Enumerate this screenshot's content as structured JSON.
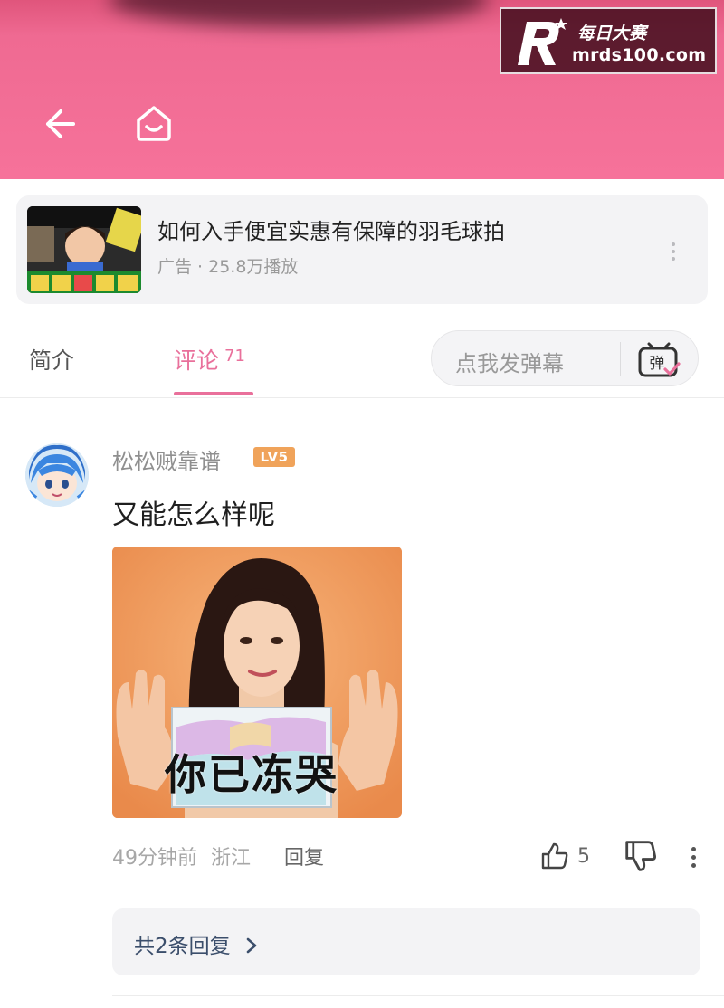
{
  "watermark": {
    "brand_cn": "每日大赛",
    "domain": "mrds100.com"
  },
  "nav": {
    "back_icon": "back-arrow-icon",
    "home_icon": "home-icon"
  },
  "ad": {
    "title": "如何入手便宜实惠有保障的羽毛球拍",
    "meta": "广告 · 25.8万播放"
  },
  "tabs": {
    "intro": "简介",
    "comments": "评论",
    "comments_count": "71",
    "danmaku_placeholder": "点我发弹幕",
    "danmaku_icon_label": "弹"
  },
  "comment": {
    "username": "松松贼靠谱",
    "level": "LV5",
    "text": "又能怎么样呢",
    "image_caption": "你已冻哭",
    "time": "49分钟前",
    "location": "浙江",
    "reply_label": "回复",
    "likes": "5",
    "replies_summary": "共2条回复"
  },
  "colors": {
    "header_pink": "#f6729a",
    "accent_pink": "#e9709b",
    "level_orange": "#f0a35a"
  }
}
